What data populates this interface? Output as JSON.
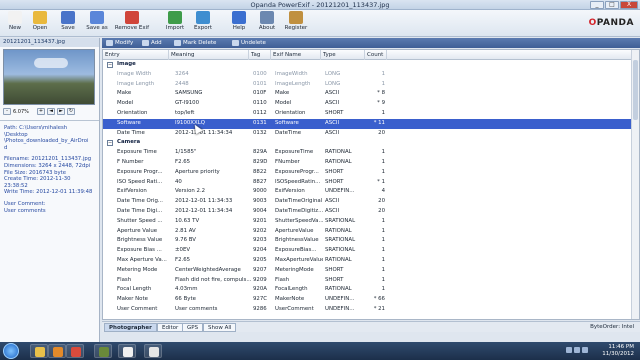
{
  "window": {
    "title": "Opanda PowerExif - 20121201_113437.jpg",
    "controls": [
      "_",
      "□",
      "X"
    ]
  },
  "toolbar": {
    "buttons": [
      {
        "label": "New",
        "icon": "new-doc-icon",
        "color": "#f2f2f2"
      },
      {
        "label": "Open",
        "icon": "open-folder-icon",
        "color": "#e9b93e"
      },
      {
        "label": "Save",
        "icon": "save-disk-icon",
        "color": "#4a74c9"
      },
      {
        "label": "Save as",
        "icon": "save-as-icon",
        "color": "#5a86d9"
      },
      {
        "label": "Remove Exif",
        "icon": "remove-exif-icon",
        "color": "#d0453a"
      },
      {
        "label": "Import",
        "icon": "import-icon",
        "color": "#3f9c4a"
      },
      {
        "label": "Export",
        "icon": "export-icon",
        "color": "#3f8ed0"
      },
      {
        "label": "Help",
        "icon": "help-icon",
        "color": "#3b6fd0"
      },
      {
        "label": "About",
        "icon": "about-icon",
        "color": "#6c88b0"
      },
      {
        "label": "Register",
        "icon": "register-icon",
        "color": "#c09040"
      }
    ],
    "brand_prefix": "",
    "brand_o": "O",
    "brand_rest": "PANDA"
  },
  "left_panel": {
    "filename": "20121201_113437.jpg",
    "zoom": "6.07%",
    "zoom_buttons": [
      "-",
      "+",
      "◄",
      "►",
      "↻"
    ],
    "path_lines": [
      "Path: C:\\Users\\mihalesh",
      "\\Desktop",
      "\\Photos_downloaded_by_AirDroi",
      "d"
    ],
    "file_lines": [
      "Filename: 20121201_113437.jpg",
      "Dimensions: 3264 x 2448, 72dpi",
      "File Size: 2016743 byte",
      "Create Time: 2012-11-30",
      "23:38:52",
      "Write Time: 2012-12-01 11:39:48"
    ],
    "comment_lines": [
      "User Comment:",
      "User comments"
    ]
  },
  "action_bar": [
    "Modify",
    "Add",
    "Mark Delete",
    "Undelete"
  ],
  "table": {
    "columns": [
      "Entry",
      "Meaning",
      "Tag",
      "Exif Name",
      "Type",
      "Count"
    ],
    "rows": [
      {
        "kind": "group",
        "entry": "Image",
        "sym": "−"
      },
      {
        "kind": "grey",
        "entry": "Image Width",
        "meaning": "3264",
        "tag": "0100",
        "name": "ImageWidth",
        "type": "LONG",
        "count": "1"
      },
      {
        "kind": "grey",
        "entry": "Image Length",
        "meaning": "2448",
        "tag": "0101",
        "name": "ImageLength",
        "type": "LONG",
        "count": "1"
      },
      {
        "kind": "normal",
        "entry": "Make",
        "meaning": "SAMSUNG",
        "tag": "010F",
        "name": "Make",
        "type": "ASCII",
        "count": "* 8"
      },
      {
        "kind": "normal",
        "entry": "Model",
        "meaning": "GT-I9100",
        "tag": "0110",
        "name": "Model",
        "type": "ASCII",
        "count": "* 9"
      },
      {
        "kind": "normal",
        "entry": "Orientation",
        "meaning": "top/left",
        "tag": "0112",
        "name": "Orientation",
        "type": "SHORT",
        "count": "1"
      },
      {
        "kind": "sel",
        "entry": "Software",
        "meaning": "I9100XXLQ",
        "tag": "0131",
        "name": "Software",
        "type": "ASCII",
        "count": "* 11"
      },
      {
        "kind": "normal",
        "entry": "Date Time",
        "meaning": "2012-12-01 11:34:34",
        "tag": "0132",
        "name": "DateTime",
        "type": "ASCII",
        "count": "20"
      },
      {
        "kind": "group",
        "entry": "Camera",
        "sym": "−"
      },
      {
        "kind": "normal",
        "entry": "Exposure Time",
        "meaning": "1/1585\"",
        "tag": "829A",
        "name": "ExposureTime",
        "type": "RATIONAL",
        "count": "1"
      },
      {
        "kind": "normal",
        "entry": "F Number",
        "meaning": "F2.65",
        "tag": "829D",
        "name": "FNumber",
        "type": "RATIONAL",
        "count": "1"
      },
      {
        "kind": "normal",
        "entry": "Exposure Progr...",
        "meaning": "Aperture priority",
        "tag": "8822",
        "name": "ExposureProgr...",
        "type": "SHORT",
        "count": "1"
      },
      {
        "kind": "normal",
        "entry": "ISO Speed Rati...",
        "meaning": "40",
        "tag": "8827",
        "name": "ISOSpeedRatin...",
        "type": "SHORT",
        "count": "* 1"
      },
      {
        "kind": "normal",
        "entry": "ExifVersion",
        "meaning": "Version 2.2",
        "tag": "9000",
        "name": "ExifVersion",
        "type": "UNDEFIN...",
        "count": "4"
      },
      {
        "kind": "normal",
        "entry": "Date Time Orig...",
        "meaning": "2012-12-01 11:34:33",
        "tag": "9003",
        "name": "DateTimeOriginal",
        "type": "ASCII",
        "count": "20"
      },
      {
        "kind": "normal",
        "entry": "Date Time Digi...",
        "meaning": "2012-12-01 11:34:34",
        "tag": "9004",
        "name": "DateTimeDigitiz...",
        "type": "ASCII",
        "count": "20"
      },
      {
        "kind": "normal",
        "entry": "Shutter Speed ...",
        "meaning": "10.63 TV",
        "tag": "9201",
        "name": "ShutterSpeedVa...",
        "type": "SRATIONAL",
        "count": "1"
      },
      {
        "kind": "normal",
        "entry": "Aperture Value",
        "meaning": "2.81 AV",
        "tag": "9202",
        "name": "ApertureValue",
        "type": "RATIONAL",
        "count": "1"
      },
      {
        "kind": "normal",
        "entry": "Brightness Value",
        "meaning": "9.76 BV",
        "tag": "9203",
        "name": "BrightnessValue",
        "type": "SRATIONAL",
        "count": "1"
      },
      {
        "kind": "normal",
        "entry": "Exposure Bias ...",
        "meaning": "±0EV",
        "tag": "9204",
        "name": "ExposureBias...",
        "type": "SRATIONAL",
        "count": "1"
      },
      {
        "kind": "normal",
        "entry": "Max Aperture Va...",
        "meaning": "F2.65",
        "tag": "9205",
        "name": "MaxApertureValue",
        "type": "RATIONAL",
        "count": "1"
      },
      {
        "kind": "normal",
        "entry": "Metering Mode",
        "meaning": "CenterWeightedAverage",
        "tag": "9207",
        "name": "MeteringMode",
        "type": "SHORT",
        "count": "1"
      },
      {
        "kind": "normal",
        "entry": "Flash",
        "meaning": "Flash did not fire, compuls...",
        "tag": "9209",
        "name": "Flash",
        "type": "SHORT",
        "count": "1"
      },
      {
        "kind": "normal",
        "entry": "Focal Length",
        "meaning": "4.03mm",
        "tag": "920A",
        "name": "FocalLength",
        "type": "RATIONAL",
        "count": "1"
      },
      {
        "kind": "normal",
        "entry": "Maker Note",
        "meaning": "66 Byte",
        "tag": "927C",
        "name": "MakerNote",
        "type": "UNDEFIN...",
        "count": "* 66"
      },
      {
        "kind": "normal",
        "entry": "User Comment",
        "meaning": "User comments",
        "tag": "9286",
        "name": "UserComment",
        "type": "UNDEFIN...",
        "count": "* 21"
      }
    ]
  },
  "bottom_tabs": [
    "Photographer",
    "Editor",
    "GPS",
    "Show All"
  ],
  "byte_order": "ByteOrder: Intel",
  "taskbar": {
    "apps": [
      {
        "icon": "explorer-icon",
        "color": "#e8c04a"
      },
      {
        "icon": "media-player-icon",
        "color": "#e38a2a"
      },
      {
        "icon": "chrome-icon",
        "color": "#d94b3c"
      },
      {
        "icon": "photo-app-icon",
        "color": "#6a8a3a"
      },
      {
        "icon": "panda-app-icon",
        "color": "#f0f0f0"
      },
      {
        "icon": "powerexif-icon",
        "color": "#e5e5e5"
      }
    ],
    "time": "11:46 PM",
    "date": "11/30/2012"
  }
}
